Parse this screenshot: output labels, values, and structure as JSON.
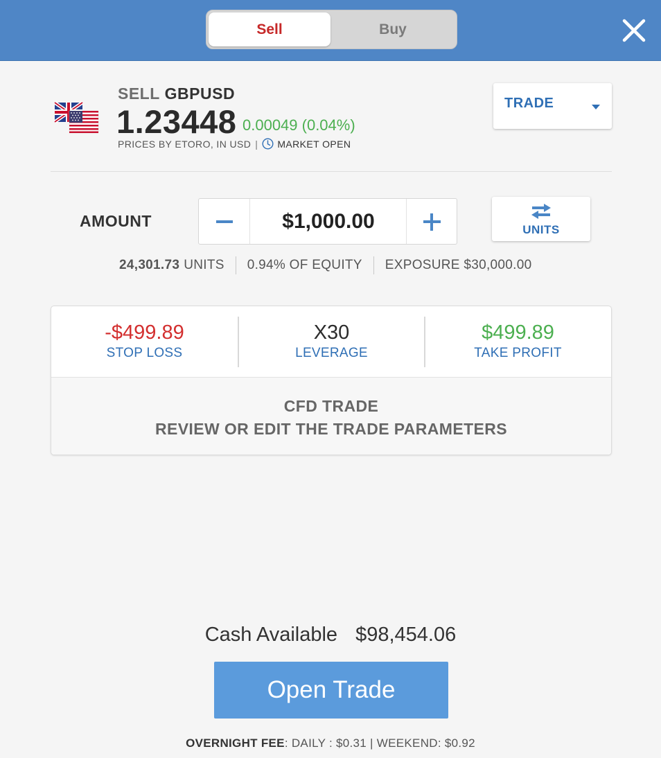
{
  "tabs": {
    "sell": "Sell",
    "buy": "Buy"
  },
  "instrument": {
    "action": "SELL",
    "symbol": "GBPUSD",
    "price": "1.23448",
    "change": "0.00049 (0.04%)",
    "prices_by": "PRICES BY ETORO, IN USD",
    "separator": "|",
    "market_status": "MARKET OPEN"
  },
  "order_type": {
    "selected": "TRADE"
  },
  "amount": {
    "label": "AMOUNT",
    "value": "$1,000.00",
    "toggle_label": "UNITS",
    "units_value": "24,301.73",
    "units_suffix": "UNITS",
    "equity": "0.94% OF EQUITY",
    "exposure": "EXPOSURE $30,000.00"
  },
  "params": {
    "stop_loss_value": "-$499.89",
    "stop_loss_label": "STOP LOSS",
    "leverage_value": "X30",
    "leverage_label": "LEVERAGE",
    "take_profit_value": "$499.89",
    "take_profit_label": "TAKE PROFIT",
    "notice_title": "CFD TRADE",
    "notice_subtitle": "REVIEW OR EDIT THE TRADE PARAMETERS"
  },
  "footer": {
    "cash_label": "Cash Available",
    "cash_value": "$98,454.06",
    "open_button": "Open Trade",
    "fee_label": "OVERNIGHT FEE",
    "fee_detail": ": DAILY : $0.31 | WEEKEND: $0.92"
  },
  "colors": {
    "header": "#4f86c6",
    "sell_red": "#c62828",
    "positive_green": "#4caf50",
    "link_blue": "#2f6fb5",
    "button_blue": "#5b9bdc"
  }
}
